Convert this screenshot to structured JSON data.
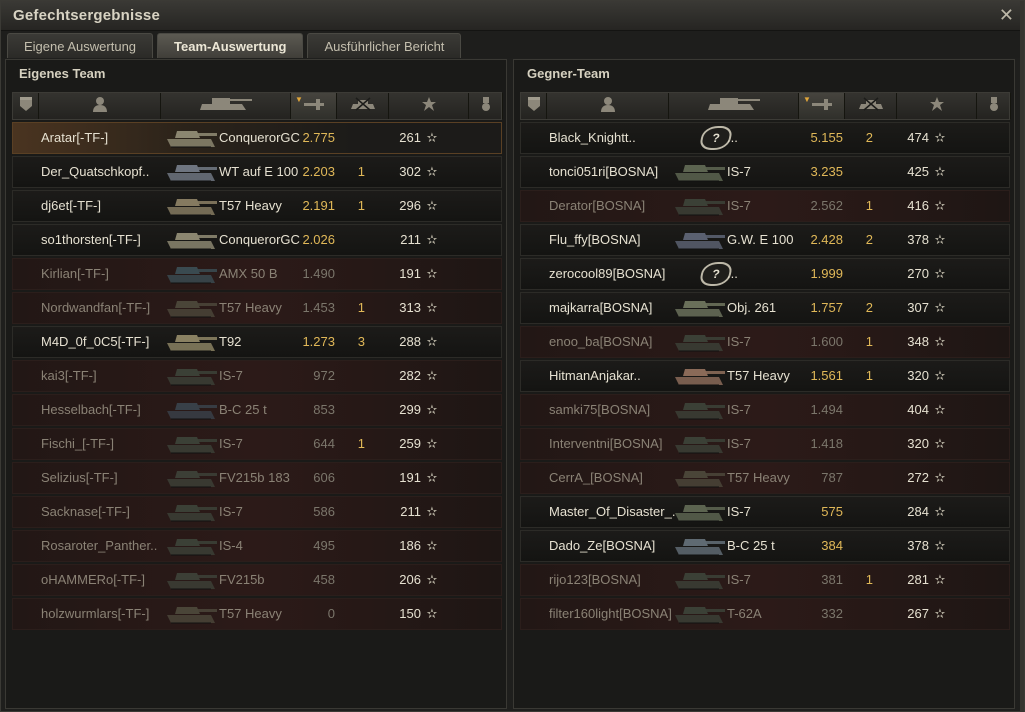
{
  "window": {
    "title": "Gefechtsergebnisse",
    "close_glyph": "✕"
  },
  "tabs": [
    {
      "label": "Eigene Auswertung",
      "active": false
    },
    {
      "label": "Team-Auswertung",
      "active": true
    },
    {
      "label": "Ausführlicher Bericht",
      "active": false
    }
  ],
  "columns": [
    {
      "icon": "rank-shield-icon"
    },
    {
      "icon": "player-icon"
    },
    {
      "icon": "tank-icon"
    },
    {
      "icon": "damage-icon",
      "sorted": true
    },
    {
      "icon": "kills-icon"
    },
    {
      "icon": "xp-star-icon"
    },
    {
      "icon": "medal-icon"
    }
  ],
  "own_team": {
    "title": "Eigenes Team",
    "rows": [
      {
        "player": "Aratar[-TF-]",
        "tank": "ConquerorGC",
        "damage": "2.775",
        "kills": "",
        "xp": "261",
        "alive": true,
        "highlight": true,
        "tank_color": "#8b8670"
      },
      {
        "player": "Der_Quatschkopf..",
        "tank": "WT auf E 100",
        "damage": "2.203",
        "kills": "1",
        "xp": "302",
        "alive": true,
        "tank_color": "#6e7580"
      },
      {
        "player": "dj6et[-TF-]",
        "tank": "T57 Heavy",
        "damage": "2.191",
        "kills": "1",
        "xp": "296",
        "alive": true,
        "tank_color": "#857a60"
      },
      {
        "player": "so1thorsten[-TF-]",
        "tank": "ConquerorGC",
        "damage": "2.026",
        "kills": "",
        "xp": "211",
        "alive": true,
        "tank_color": "#8b8670"
      },
      {
        "player": "Kirlian[-TF-]",
        "tank": "AMX 50 B",
        "damage": "1.490",
        "kills": "",
        "xp": "191",
        "alive": false,
        "tank_color": "#3a4a50"
      },
      {
        "player": "Nordwandfan[-TF-]",
        "tank": "T57 Heavy",
        "damage": "1.453",
        "kills": "1",
        "xp": "313",
        "alive": false,
        "tank_color": "#4a4538"
      },
      {
        "player": "M4D_0f_0C5[-TF-]",
        "tank": "T92",
        "damage": "1.273",
        "kills": "3",
        "xp": "288",
        "alive": true,
        "tank_color": "#8a8162"
      },
      {
        "player": "kai3[-TF-]",
        "tank": "IS-7",
        "damage": "972",
        "kills": "",
        "xp": "282",
        "alive": false,
        "tank_color": "#3b4036"
      },
      {
        "player": "Hesselbach[-TF-]",
        "tank": "B-C 25 t",
        "damage": "853",
        "kills": "",
        "xp": "299",
        "alive": false,
        "tank_color": "#384048"
      },
      {
        "player": "Fischi_[-TF-]",
        "tank": "IS-7",
        "damage": "644",
        "kills": "1",
        "xp": "259",
        "alive": false,
        "tank_color": "#3b4036"
      },
      {
        "player": "Selizius[-TF-]",
        "tank": "FV215b 183",
        "damage": "606",
        "kills": "",
        "xp": "191",
        "alive": false,
        "tank_color": "#3c3f36"
      },
      {
        "player": "Sacknase[-TF-]",
        "tank": "IS-7",
        "damage": "586",
        "kills": "",
        "xp": "211",
        "alive": false,
        "tank_color": "#3b4036"
      },
      {
        "player": "Rosaroter_Panther..",
        "tank": "IS-4",
        "damage": "495",
        "kills": "",
        "xp": "186",
        "alive": false,
        "tank_color": "#3b4036"
      },
      {
        "player": "oHAMMERo[-TF-]",
        "tank": "FV215b",
        "damage": "458",
        "kills": "",
        "xp": "206",
        "alive": false,
        "tank_color": "#3c3f36"
      },
      {
        "player": "holzwurmlars[-TF-]",
        "tank": "T57 Heavy",
        "damage": "0",
        "kills": "",
        "xp": "150",
        "alive": false,
        "tank_color": "#4a4538"
      }
    ]
  },
  "enemy_team": {
    "title": "Gegner-Team",
    "rows": [
      {
        "player": "Black_Knightt..",
        "tank": "...",
        "damage": "5.155",
        "kills": "2",
        "xp": "474",
        "alive": true,
        "unknown": true
      },
      {
        "player": "tonci051ri[BOSNA]",
        "tank": "IS-7",
        "damage": "3.235",
        "kills": "",
        "xp": "425",
        "alive": true,
        "tank_color": "#5c6450"
      },
      {
        "player": "Derator[BOSNA]",
        "tank": "IS-7",
        "damage": "2.562",
        "kills": "1",
        "xp": "416",
        "alive": false,
        "tank_color": "#3b4036"
      },
      {
        "player": "Flu_ffy[BOSNA]",
        "tank": "G.W. E 100",
        "damage": "2.428",
        "kills": "2",
        "xp": "378",
        "alive": true,
        "tank_color": "#5a6070"
      },
      {
        "player": "zerocool89[BOSNA]",
        "tank": "...",
        "damage": "1.999",
        "kills": "",
        "xp": "270",
        "alive": true,
        "unknown": true
      },
      {
        "player": "majkarra[BOSNA]",
        "tank": "Obj. 261",
        "damage": "1.757",
        "kills": "2",
        "xp": "307",
        "alive": true,
        "tank_color": "#6a705a"
      },
      {
        "player": "enoo_ba[BOSNA]",
        "tank": "IS-7",
        "damage": "1.600",
        "kills": "1",
        "xp": "348",
        "alive": false,
        "tank_color": "#3b4036"
      },
      {
        "player": "HitmanAnjakar..",
        "tank": "T57 Heavy",
        "damage": "1.561",
        "kills": "1",
        "xp": "320",
        "alive": true,
        "tank_color": "#8a6a58"
      },
      {
        "player": "samki75[BOSNA]",
        "tank": "IS-7",
        "damage": "1.494",
        "kills": "",
        "xp": "404",
        "alive": false,
        "tank_color": "#3b4036"
      },
      {
        "player": "Interventni[BOSNA]",
        "tank": "IS-7",
        "damage": "1.418",
        "kills": "",
        "xp": "320",
        "alive": false,
        "tank_color": "#3b4036"
      },
      {
        "player": "CerrA_[BOSNA]",
        "tank": "T57 Heavy",
        "damage": "787",
        "kills": "",
        "xp": "272",
        "alive": false,
        "tank_color": "#4a4538"
      },
      {
        "player": "Master_Of_Disaster_..",
        "tank": "IS-7",
        "damage": "575",
        "kills": "",
        "xp": "284",
        "alive": true,
        "tank_color": "#5c6450"
      },
      {
        "player": "Dado_Ze[BOSNA]",
        "tank": "B-C 25 t",
        "damage": "384",
        "kills": "",
        "xp": "378",
        "alive": true,
        "tank_color": "#5f6a72"
      },
      {
        "player": "rijo123[BOSNA]",
        "tank": "IS-7",
        "damage": "381",
        "kills": "1",
        "xp": "281",
        "alive": false,
        "tank_color": "#3b4036"
      },
      {
        "player": "filter160light[BOSNA]",
        "tank": "T-62A",
        "damage": "332",
        "kills": "",
        "xp": "267",
        "alive": false,
        "tank_color": "#3b4036"
      }
    ]
  },
  "star_glyph": "✫",
  "unknown_glyph": "?"
}
